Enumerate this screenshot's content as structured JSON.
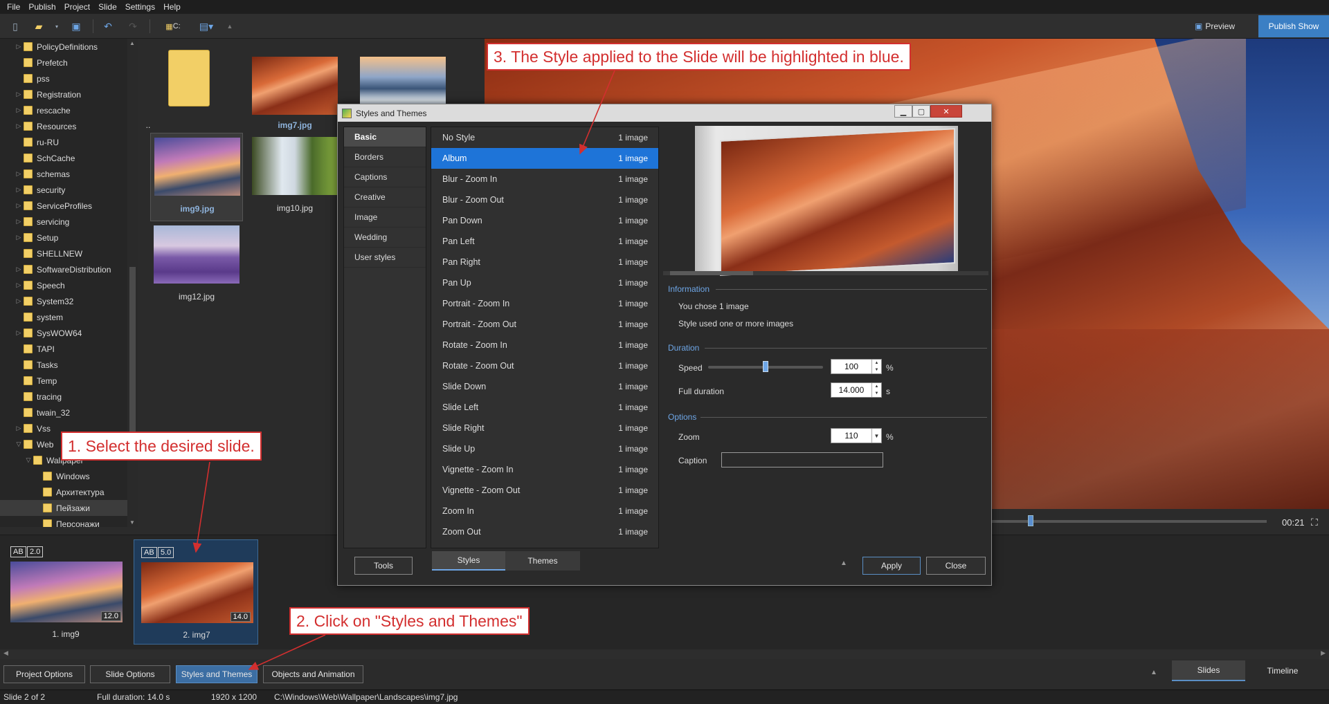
{
  "menu": [
    "File",
    "Publish",
    "Project",
    "Slide",
    "Settings",
    "Help"
  ],
  "toolbar": {
    "drive_label": "C:",
    "preview_label": "Preview",
    "publish_label": "Publish Show"
  },
  "tree": {
    "items": [
      {
        "label": "PolicyDefinitions",
        "arrow": "›",
        "level": 0
      },
      {
        "label": "Prefetch",
        "arrow": "",
        "level": 0
      },
      {
        "label": "pss",
        "arrow": "",
        "level": 0
      },
      {
        "label": "Registration",
        "arrow": "›",
        "level": 0
      },
      {
        "label": "rescache",
        "arrow": "›",
        "level": 0
      },
      {
        "label": "Resources",
        "arrow": "›",
        "level": 0
      },
      {
        "label": "ru-RU",
        "arrow": "",
        "level": 0
      },
      {
        "label": "SchCache",
        "arrow": "",
        "level": 0
      },
      {
        "label": "schemas",
        "arrow": "›",
        "level": 0
      },
      {
        "label": "security",
        "arrow": "›",
        "level": 0
      },
      {
        "label": "ServiceProfiles",
        "arrow": "›",
        "level": 0
      },
      {
        "label": "servicing",
        "arrow": "›",
        "level": 0
      },
      {
        "label": "Setup",
        "arrow": "›",
        "level": 0
      },
      {
        "label": "SHELLNEW",
        "arrow": "",
        "level": 0
      },
      {
        "label": "SoftwareDistribution",
        "arrow": "›",
        "level": 0
      },
      {
        "label": "Speech",
        "arrow": "›",
        "level": 0
      },
      {
        "label": "System32",
        "arrow": "›",
        "level": 0
      },
      {
        "label": "system",
        "arrow": "",
        "level": 0
      },
      {
        "label": "SysWOW64",
        "arrow": "›",
        "level": 0
      },
      {
        "label": "TAPI",
        "arrow": "",
        "level": 0
      },
      {
        "label": "Tasks",
        "arrow": "",
        "level": 0
      },
      {
        "label": "Temp",
        "arrow": "",
        "level": 0
      },
      {
        "label": "tracing",
        "arrow": "",
        "level": 0
      },
      {
        "label": "twain_32",
        "arrow": "",
        "level": 0
      },
      {
        "label": "Vss",
        "arrow": "›",
        "level": 0
      },
      {
        "label": "Web",
        "arrow": "⌄",
        "level": 0
      },
      {
        "label": "Wallpaper",
        "arrow": "⌄",
        "level": 1
      },
      {
        "label": "Windows",
        "arrow": "",
        "level": 2
      },
      {
        "label": "Архитектура",
        "arrow": "",
        "level": 2
      },
      {
        "label": "Пейзажи",
        "arrow": "",
        "level": 2,
        "selected": true
      },
      {
        "label": "Персонажи",
        "arrow": "",
        "level": 2
      }
    ]
  },
  "browser": {
    "thumbs": [
      {
        "label": "..",
        "kind": "folder"
      },
      {
        "label": "img7.jpg",
        "kind": "canyon",
        "selected": false,
        "bold": true
      },
      {
        "label": "",
        "kind": "glacier"
      },
      {
        "label": "img9.jpg",
        "kind": "sunset",
        "selected": true
      },
      {
        "label": "img10.jpg",
        "kind": "waterfall"
      },
      {
        "label": "img12.jpg",
        "kind": "lavender"
      }
    ]
  },
  "player": {
    "time": "00:21"
  },
  "slides": [
    {
      "badge_ab": "AB",
      "badge_time": "2.0",
      "duration": "12.0",
      "caption": "1. img9",
      "kind": "sunset",
      "selected": false
    },
    {
      "badge_ab": "AB",
      "badge_time": "5.0",
      "duration": "14.0",
      "caption": "2. img7",
      "kind": "canyon",
      "selected": true
    }
  ],
  "bottom": {
    "project_options": "Project Options",
    "slide_options": "Slide Options",
    "styles_themes": "Styles and Themes",
    "objects_animation": "Objects and Animation",
    "tab_slides": "Slides",
    "tab_timeline": "Timeline"
  },
  "status": {
    "slide": "Slide 2 of 2",
    "duration": "Full duration: 14.0 s",
    "resolution": "1920 x 1200",
    "path": "C:\\Windows\\Web\\Wallpaper\\Landscapes\\img7.jpg"
  },
  "dialog": {
    "title": "Styles and Themes",
    "categories": [
      "Basic",
      "Borders",
      "Captions",
      "Creative",
      "Image",
      "Wedding",
      "User styles"
    ],
    "active_category": 0,
    "styles": [
      {
        "name": "No Style",
        "count": "1 image"
      },
      {
        "name": "Album",
        "count": "1 image",
        "active": true
      },
      {
        "name": "Blur - Zoom In",
        "count": "1 image"
      },
      {
        "name": "Blur - Zoom Out",
        "count": "1 image"
      },
      {
        "name": "Pan Down",
        "count": "1 image"
      },
      {
        "name": "Pan Left",
        "count": "1 image"
      },
      {
        "name": "Pan Right",
        "count": "1 image"
      },
      {
        "name": "Pan Up",
        "count": "1 image"
      },
      {
        "name": "Portrait - Zoom In",
        "count": "1 image"
      },
      {
        "name": "Portrait - Zoom Out",
        "count": "1 image"
      },
      {
        "name": "Rotate - Zoom In",
        "count": "1 image"
      },
      {
        "name": "Rotate - Zoom Out",
        "count": "1 image"
      },
      {
        "name": "Slide Down",
        "count": "1 image"
      },
      {
        "name": "Slide Left",
        "count": "1 image"
      },
      {
        "name": "Slide Right",
        "count": "1 image"
      },
      {
        "name": "Slide Up",
        "count": "1 image"
      },
      {
        "name": "Vignette - Zoom In",
        "count": "1 image"
      },
      {
        "name": "Vignette - Zoom Out",
        "count": "1 image"
      },
      {
        "name": "Zoom In",
        "count": "1 image"
      },
      {
        "name": "Zoom Out",
        "count": "1 image"
      }
    ],
    "information_label": "Information",
    "info_line1": "You chose 1 image",
    "info_line2": "Style used one or more images",
    "duration_label": "Duration",
    "speed_label": "Speed",
    "speed_value": "100",
    "speed_unit": "%",
    "speed_level": 0.5,
    "full_duration_label": "Full duration",
    "full_duration_value": "14.000",
    "full_duration_unit": "s",
    "options_label": "Options",
    "zoom_label": "Zoom",
    "zoom_value": "110",
    "zoom_unit": "%",
    "caption_label": "Caption",
    "caption_value": "",
    "tools_label": "Tools",
    "tab_styles": "Styles",
    "tab_themes": "Themes",
    "apply_label": "Apply",
    "close_label": "Close"
  },
  "callouts": {
    "step1": "1. Select the desired slide.",
    "step2": "2. Click on \"Styles and Themes\"",
    "step3": "3. The Style applied to the Slide will be highlighted in blue."
  },
  "colors": {
    "accent": "#1e74d8",
    "callout_red": "#d32f2f"
  }
}
